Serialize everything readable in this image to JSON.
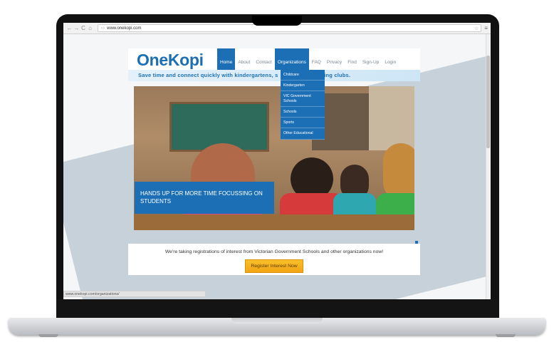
{
  "browser": {
    "url": "www.onekopi.com",
    "status_url": "www.onekopi.com/organizations/"
  },
  "site": {
    "logo": "OneKopi",
    "tagline_left": "Save time and connect quickly with kindergartens, s",
    "tagline_right": "ting clubs.",
    "nav": [
      {
        "label": "Home",
        "active": true
      },
      {
        "label": "About",
        "active": false
      },
      {
        "label": "Contact",
        "active": false
      },
      {
        "label": "Organizations",
        "active": true
      },
      {
        "label": "FAQ",
        "active": false
      },
      {
        "label": "Privacy",
        "active": false
      },
      {
        "label": "Find",
        "active": false
      },
      {
        "label": "Sign-Up",
        "active": false
      },
      {
        "label": "Login",
        "active": false
      }
    ],
    "dropdown": [
      "Childcare",
      "Kindergarten",
      "VIC Government Schools",
      "Schools",
      "Sports",
      "Other Educational"
    ],
    "hero_caption": "HANDS UP FOR MORE TIME FOCUSSING ON STUDENTS",
    "cta_text": "We're taking registrations of interest from Victorian Government Schools and other organizations now!",
    "cta_button": "Register Interest Now"
  },
  "colors": {
    "brand_blue": "#1c6fb5",
    "cta_orange": "#f3a415"
  }
}
